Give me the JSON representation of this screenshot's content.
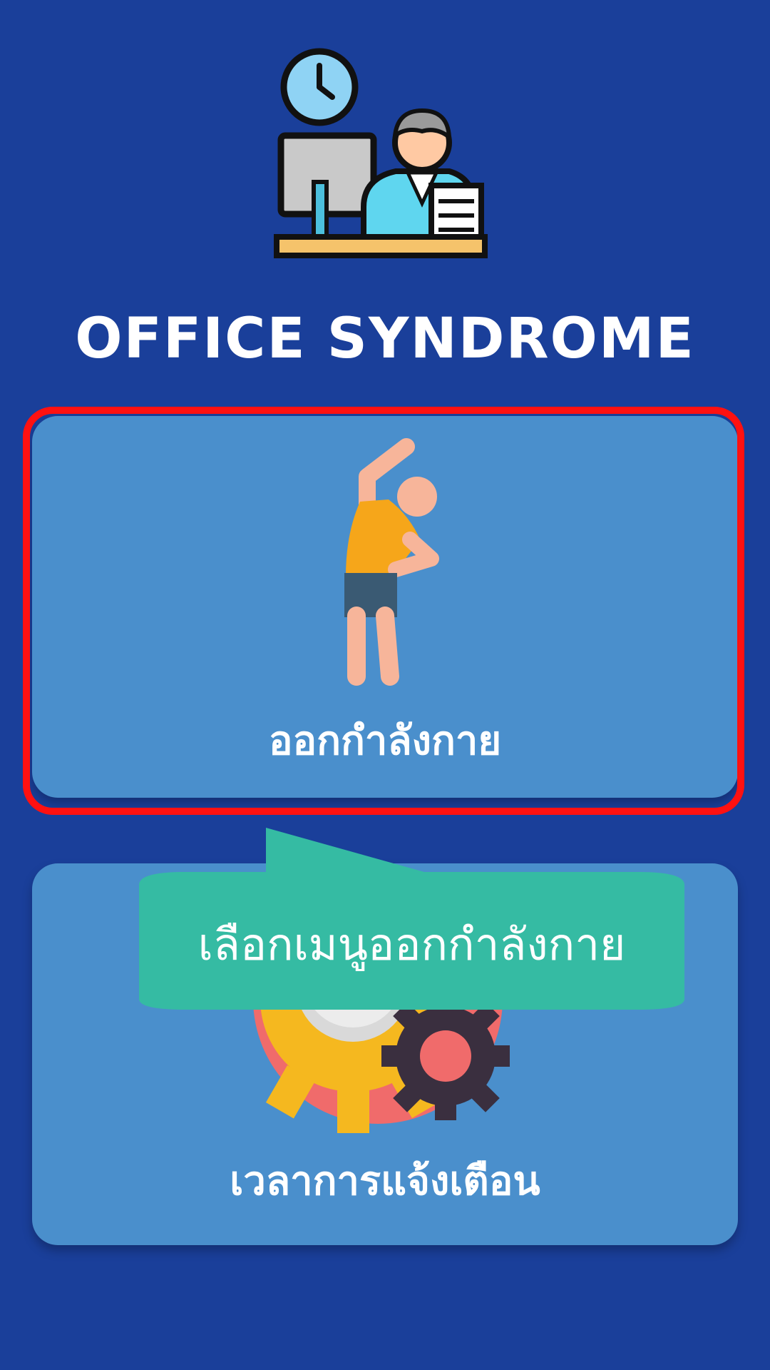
{
  "app": {
    "title": "OFFICE SYNDROME",
    "logo_icon": "office-worker-desk-icon"
  },
  "menu": {
    "items": [
      {
        "label": "ออกกำลังกาย",
        "icon": "stretching-person-icon",
        "highlighted": true
      },
      {
        "label": "เวลาการแจ้งเตือน",
        "icon": "clock-gears-icon",
        "highlighted": false
      }
    ]
  },
  "tutorial": {
    "tooltip_text": "เลือกเมนูออกกำลังกาย",
    "highlight_color": "#ff1111",
    "tooltip_color": "#35bba3"
  },
  "colors": {
    "background": "#1a3f9a",
    "card": "#4a8fcc"
  }
}
